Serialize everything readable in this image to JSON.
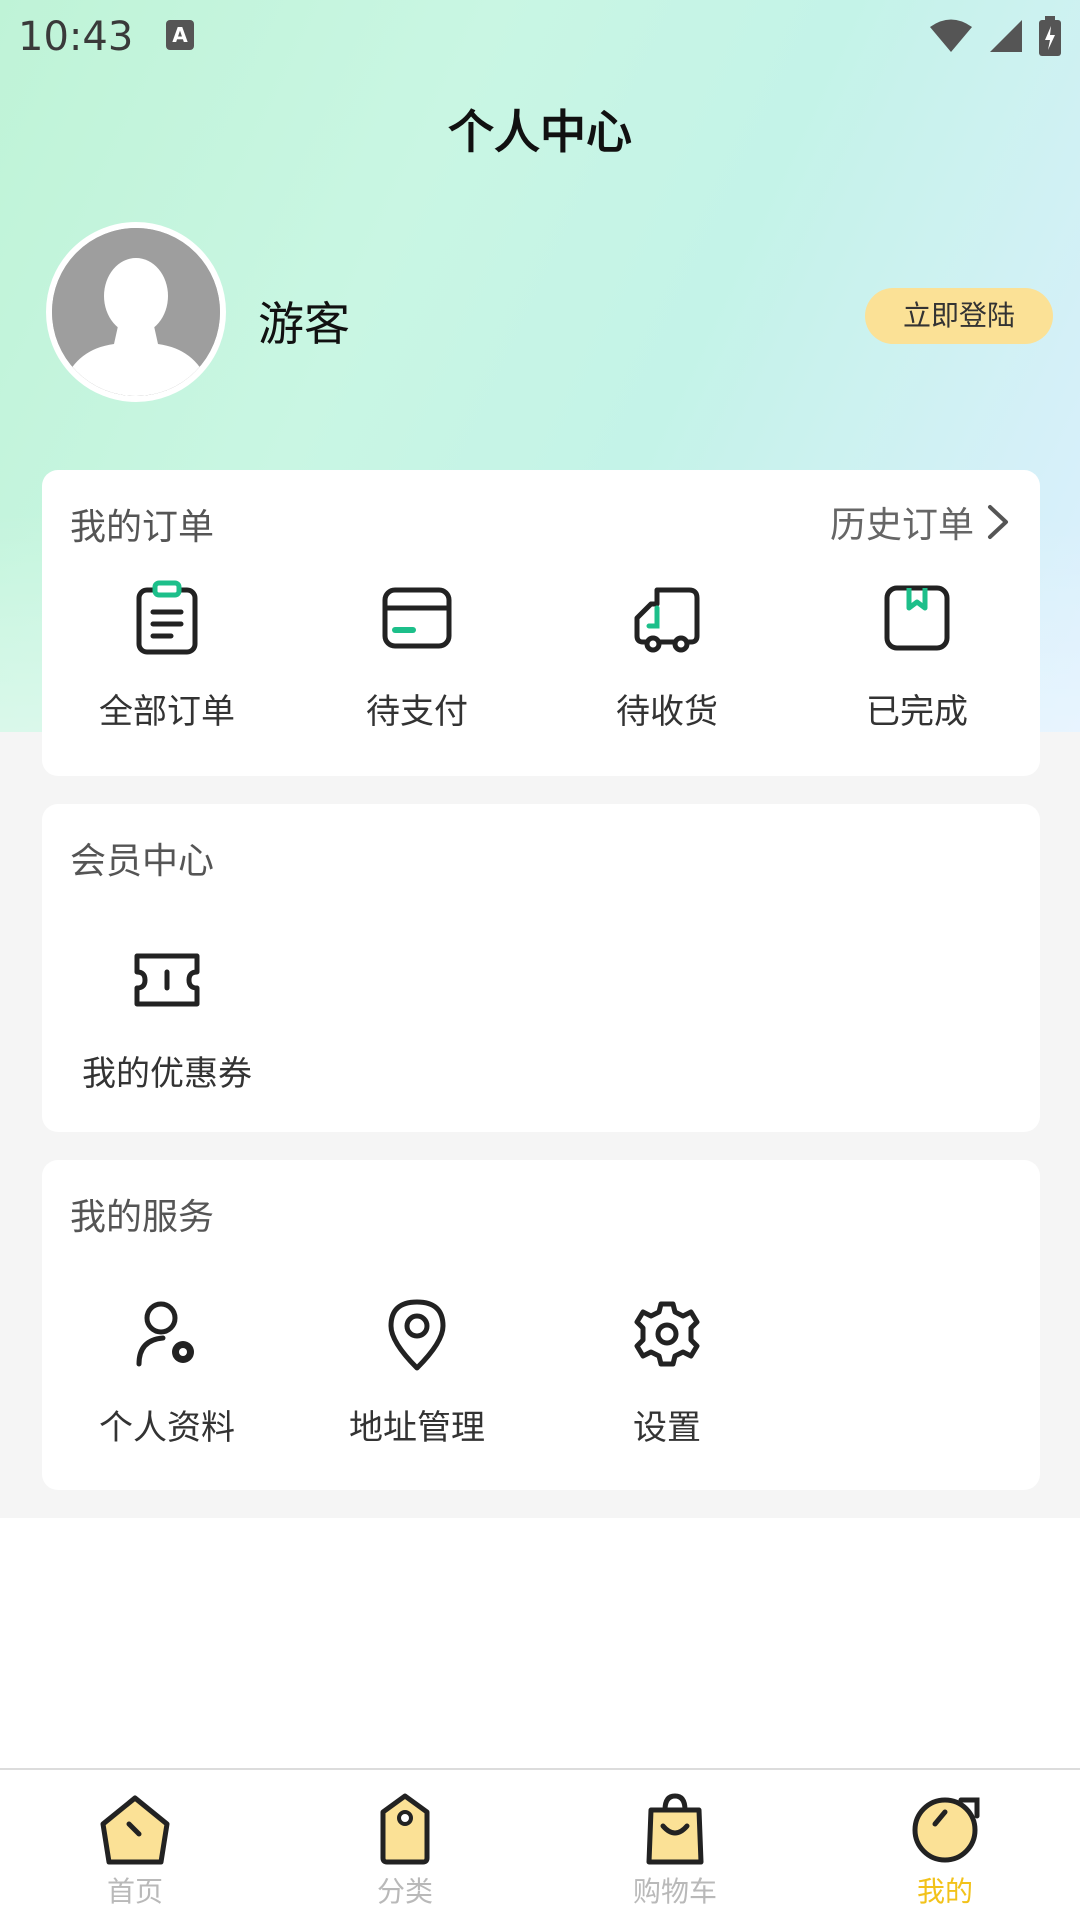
{
  "status_bar": {
    "time": "10:43",
    "notification_letter": "A"
  },
  "header": {
    "title": "个人中心"
  },
  "profile": {
    "name": "游客",
    "login_label": "立即登陆"
  },
  "orders": {
    "title": "我的订单",
    "history_label": "历史订单",
    "items": [
      {
        "label": "全部订单",
        "icon": "clipboard-icon"
      },
      {
        "label": "待支付",
        "icon": "card-icon"
      },
      {
        "label": "待收货",
        "icon": "truck-icon"
      },
      {
        "label": "已完成",
        "icon": "box-icon"
      }
    ]
  },
  "member": {
    "title": "会员中心",
    "items": [
      {
        "label": "我的优惠券",
        "icon": "ticket-icon"
      }
    ]
  },
  "services": {
    "title": "我的服务",
    "items": [
      {
        "label": "个人资料",
        "icon": "user-gear-icon"
      },
      {
        "label": "地址管理",
        "icon": "location-pin-icon"
      },
      {
        "label": "设置",
        "icon": "gear-icon"
      }
    ]
  },
  "tabbar": {
    "items": [
      {
        "label": "首页",
        "icon": "home-icon"
      },
      {
        "label": "分类",
        "icon": "tag-icon"
      },
      {
        "label": "购物车",
        "icon": "bag-icon"
      },
      {
        "label": "我的",
        "icon": "profile-icon"
      }
    ],
    "active_index": 3
  },
  "colors": {
    "accent_green": "#1dbf8a",
    "accent_yellow": "#f2c21a",
    "login_bg": "#fbe196"
  }
}
